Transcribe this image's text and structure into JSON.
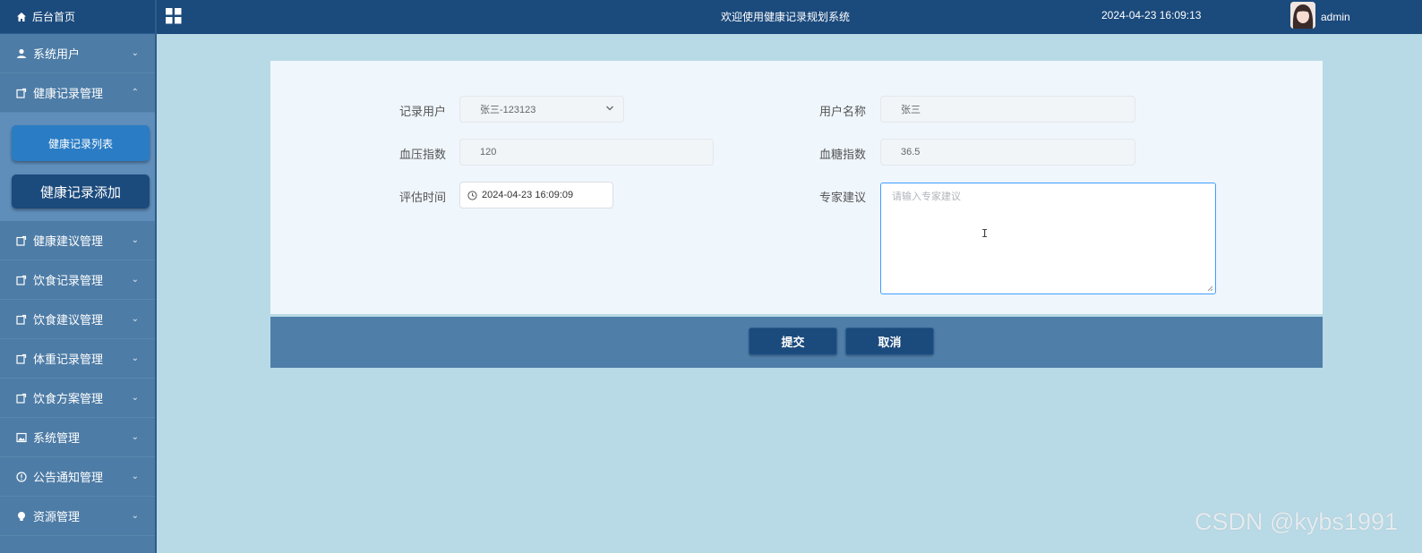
{
  "header": {
    "title": "欢迎使用健康记录规划系统",
    "datetime": "2024-04-23 16:09:13",
    "user": "admin"
  },
  "sidebar": {
    "home": "后台首页",
    "items": [
      {
        "label": "系统用户",
        "icon": "user-icon",
        "expanded": false
      },
      {
        "label": "健康记录管理",
        "icon": "edit-icon",
        "expanded": true
      },
      {
        "label": "健康建议管理",
        "icon": "edit-icon",
        "expanded": false
      },
      {
        "label": "饮食记录管理",
        "icon": "edit-icon",
        "expanded": false
      },
      {
        "label": "饮食建议管理",
        "icon": "edit-icon",
        "expanded": false
      },
      {
        "label": "体重记录管理",
        "icon": "edit-icon",
        "expanded": false
      },
      {
        "label": "饮食方案管理",
        "icon": "edit-icon",
        "expanded": false
      },
      {
        "label": "系统管理",
        "icon": "image-icon",
        "expanded": false
      },
      {
        "label": "公告通知管理",
        "icon": "info-icon",
        "expanded": false
      },
      {
        "label": "资源管理",
        "icon": "bulb-icon",
        "expanded": false
      }
    ],
    "submenu": {
      "list": "健康记录列表",
      "add": "健康记录添加"
    }
  },
  "form": {
    "record_user": {
      "label": "记录用户",
      "value": "张三-123123"
    },
    "user_name": {
      "label": "用户名称",
      "value": "张三"
    },
    "blood_pressure": {
      "label": "血压指数",
      "value": "120"
    },
    "blood_sugar": {
      "label": "血糖指数",
      "value": "36.5"
    },
    "eval_time": {
      "label": "评估时间",
      "value": "2024-04-23 16:09:09"
    },
    "expert_advice": {
      "label": "专家建议",
      "placeholder": "请输入专家建议",
      "value": ""
    }
  },
  "actions": {
    "submit": "提交",
    "cancel": "取消"
  },
  "watermark": "CSDN @kybs1991",
  "colors": {
    "header_bg": "#1b4a7c",
    "sidebar_bg": "#4d7ca6",
    "page_bg": "#b8dae6",
    "card_bg": "#eff6fc",
    "active_submenu": "#2a7cc4"
  }
}
